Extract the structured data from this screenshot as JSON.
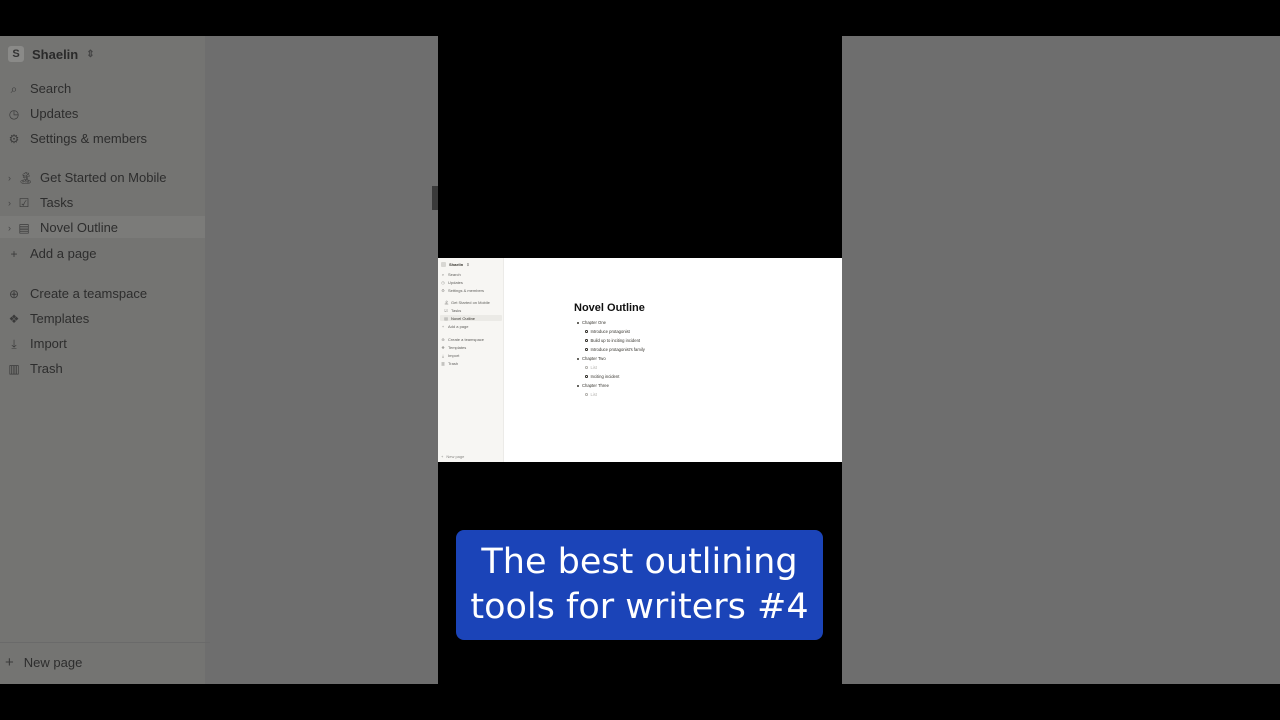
{
  "background_view": {
    "workspace": {
      "avatar": "S",
      "name": "Shaelin",
      "switcher_icon": "chevron-updown-icon"
    },
    "nav_items": [
      {
        "label": "Search",
        "icon": "search-icon"
      },
      {
        "label": "Updates",
        "icon": "clock-icon"
      },
      {
        "label": "Settings & members",
        "icon": "gear-icon"
      }
    ],
    "pages": [
      {
        "label": "Get Started on Mobile",
        "icon": "palm-tree-icon"
      },
      {
        "label": "Tasks",
        "icon": "checkbox-icon"
      },
      {
        "label": "Novel Outline",
        "icon": "page-icon"
      }
    ],
    "add_page": "Add a page",
    "tools": [
      {
        "label": "Create a teamspace",
        "icon": "teamspace-icon"
      },
      {
        "label": "Templates",
        "icon": "templates-icon"
      },
      {
        "label": "Import",
        "icon": "import-icon"
      },
      {
        "label": "Trash",
        "icon": "trash-icon"
      }
    ],
    "new_page": "New page"
  },
  "screenshot": {
    "workspace": "Shaelin",
    "nav_items": [
      "Search",
      "Updates",
      "Settings & members"
    ],
    "pages": [
      "Get Started on Mobile",
      "Tasks",
      "Novel Outline"
    ],
    "add_page": "Add a page",
    "tools": [
      "Create a teamspace",
      "Templates",
      "Import",
      "Trash"
    ],
    "new_page": "New page",
    "document": {
      "title": "Novel Outline",
      "outline": [
        {
          "level": 1,
          "text": "Chapter One"
        },
        {
          "level": 2,
          "text": "Introduce protagonist"
        },
        {
          "level": 2,
          "text": "Build up to inciting incident"
        },
        {
          "level": 2,
          "text": "Introduce protagonist's family"
        },
        {
          "level": 1,
          "text": "Chapter Two"
        },
        {
          "level": 2,
          "text": "List"
        },
        {
          "level": 2,
          "text": "Inciting incident"
        },
        {
          "level": 1,
          "text": "Chapter Three"
        },
        {
          "level": 2,
          "text": "List"
        }
      ]
    }
  },
  "caption": {
    "text": "The best outlining tools for writers #4",
    "background_color": "#1b44b8"
  }
}
